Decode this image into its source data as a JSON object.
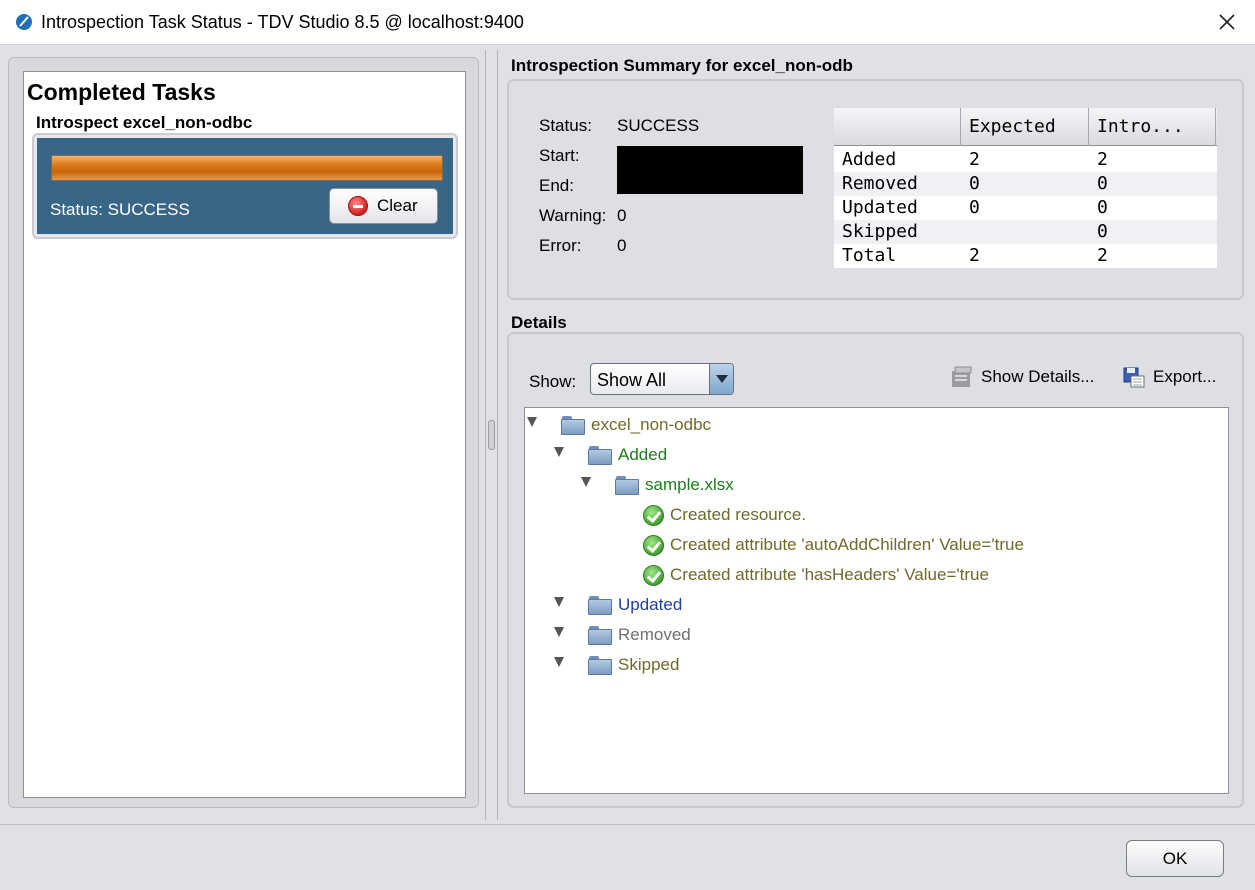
{
  "window": {
    "title": "Introspection Task Status - TDV Studio 8.5 @ localhost:9400",
    "app_icon": "tdv-logo-icon",
    "close_icon": "close-icon"
  },
  "left_panel": {
    "heading": "Completed Tasks",
    "task": {
      "name": "Introspect excel_non-odbc",
      "progress_fraction": 1.0,
      "status": "Status: SUCCESS",
      "clear_label": "Clear",
      "clear_icon": "stop-icon"
    }
  },
  "summary": {
    "title": "Introspection Summary for  excel_non-odb",
    "labels": {
      "status": "Status:",
      "start": "Start:",
      "end": "End:",
      "warning": "Warning:",
      "error": "Error:"
    },
    "values": {
      "status": "SUCCESS",
      "warning": "0",
      "error": "0"
    },
    "table": {
      "columns": [
        "",
        "Expected",
        "Intro..."
      ],
      "rows": [
        [
          "Added",
          "2",
          "2"
        ],
        [
          "Removed",
          "0",
          "0"
        ],
        [
          "Updated",
          "0",
          "0"
        ],
        [
          "Skipped",
          "",
          "0"
        ],
        [
          "Total",
          "2",
          "2"
        ]
      ]
    }
  },
  "details": {
    "title": "Details",
    "show_label": "Show:",
    "show_value": "Show All",
    "show_details_label": "Show Details...",
    "export_label": "Export...",
    "tree": {
      "root": "excel_non-odbc",
      "added": "Added",
      "file": "sample.xlsx",
      "messages": [
        "Created resource.",
        "Created attribute 'autoAddChildren' Value='true",
        "Created attribute 'hasHeaders' Value='true"
      ],
      "updated": "Updated",
      "removed": "Removed",
      "skipped": "Skipped"
    }
  },
  "footer": {
    "ok_label": "OK"
  },
  "colors": {
    "task_card": "#376686",
    "progress": "#dc7d1c",
    "added": "#1e7d1e",
    "updated": "#1f3f9a",
    "removed": "#6f6f6f",
    "olive": "#6f6a2a"
  }
}
